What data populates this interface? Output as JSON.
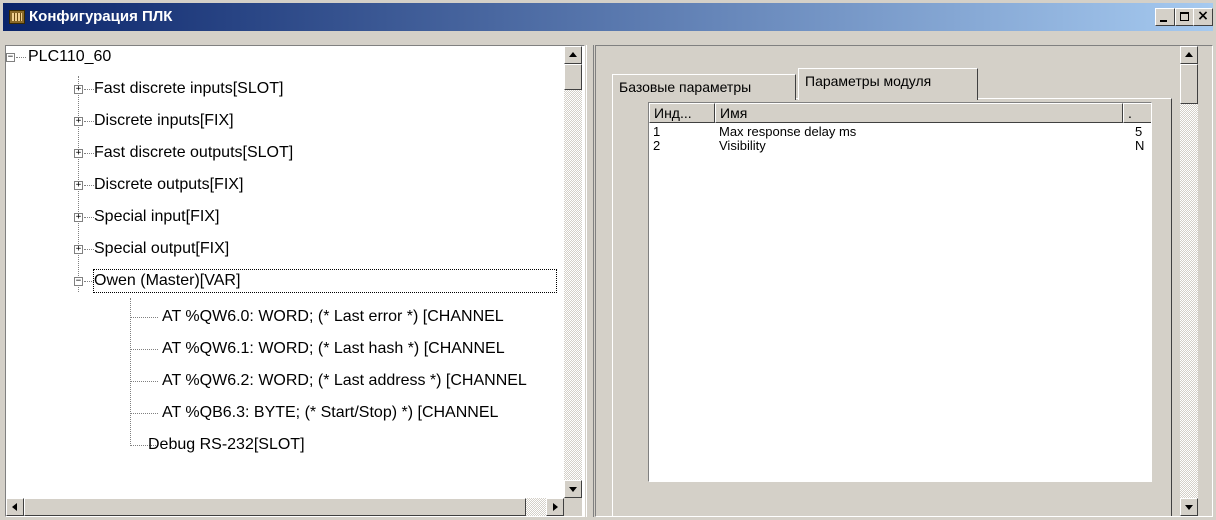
{
  "window": {
    "title": "Конфигурация ПЛК",
    "icon": "plc-config-icon",
    "controls": {
      "close_glyph": "×"
    }
  },
  "tree": {
    "root": {
      "label": "PLC110_60",
      "expanded": true
    },
    "modules": [
      {
        "label": "Fast discrete inputs[SLOT]",
        "expanded": false
      },
      {
        "label": "Discrete inputs[FIX]",
        "expanded": false
      },
      {
        "label": "Fast discrete outputs[SLOT]",
        "expanded": false
      },
      {
        "label": "Discrete outputs[FIX]",
        "expanded": false
      },
      {
        "label": "Special input[FIX]",
        "expanded": false
      },
      {
        "label": "Special output[FIX]",
        "expanded": false
      },
      {
        "label": "Owen (Master)[VAR]",
        "expanded": true,
        "selected": true
      }
    ],
    "children": [
      "AT %QW6.0: WORD; (* Last error *) [CHANNEL",
      "AT %QW6.1: WORD; (* Last hash *) [CHANNEL",
      "AT %QW6.2: WORD; (* Last address *) [CHANNEL",
      "AT %QB6.3: BYTE; (* Start/Stop) *) [CHANNEL",
      "Debug RS-232[SLOT]"
    ],
    "expand_glyph": "+",
    "collapse_glyph": "−"
  },
  "tabs": [
    {
      "label": "Базовые параметры",
      "active": false
    },
    {
      "label": "Параметры модуля",
      "active": true
    }
  ],
  "parameters": {
    "columns": [
      "Инд...",
      "Имя",
      "."
    ],
    "rows": [
      {
        "index": "1",
        "name": "Max response delay ms",
        "value": "5"
      },
      {
        "index": "2",
        "name": "Visibility",
        "value": "N"
      }
    ]
  },
  "colors": {
    "titlebar_start": "#0a246a",
    "titlebar_end": "#a6caf0",
    "face": "#d4d0c8"
  }
}
